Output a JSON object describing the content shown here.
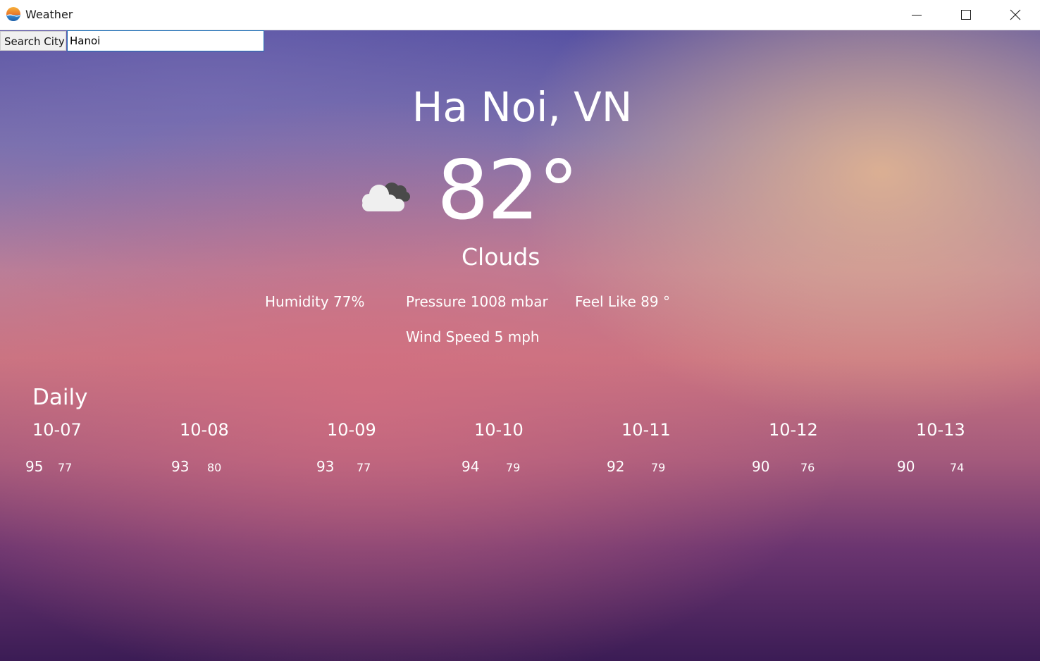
{
  "window": {
    "title": "Weather",
    "icon": "weather-app-icon",
    "controls": {
      "minimize": "minimize-icon",
      "maximize": "maximize-icon",
      "close": "close-icon"
    }
  },
  "search": {
    "label": "Search City",
    "value": "Hanoi"
  },
  "current": {
    "city": "Ha Noi, VN",
    "temperature": "82°",
    "condition": "Clouds",
    "condition_icon": "cloudy-icon",
    "humidity": "Humidity 77%",
    "pressure": "Pressure 1008 mbar",
    "feel_like": "Feel Like 89 °",
    "wind_speed": "Wind Speed 5 mph"
  },
  "daily": {
    "title": "Daily",
    "days": [
      {
        "date": "10-07",
        "high": "95",
        "low": "77"
      },
      {
        "date": "10-08",
        "high": "93",
        "low": "80"
      },
      {
        "date": "10-09",
        "high": "93",
        "low": "77"
      },
      {
        "date": "10-10",
        "high": "94",
        "low": "79"
      },
      {
        "date": "10-11",
        "high": "92",
        "low": "79"
      },
      {
        "date": "10-12",
        "high": "90",
        "low": "76"
      },
      {
        "date": "10-13",
        "high": "90",
        "low": "74"
      }
    ]
  },
  "colors": {
    "background_top": "#5550a2",
    "background_mid": "#c97582",
    "background_bottom": "#3b1c55",
    "text": "#ffffff",
    "input_border": "#1e6fb8"
  }
}
